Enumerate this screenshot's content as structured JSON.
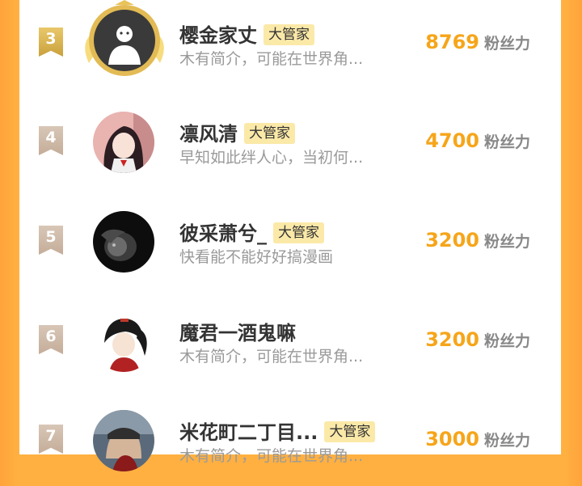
{
  "fans_unit": "粉丝力",
  "rows": [
    {
      "rank": "3",
      "name": "樱金家丈",
      "badge": "大管家",
      "desc": "木有简介，可能在世界角...",
      "fans": "8769"
    },
    {
      "rank": "4",
      "name": "凛风清",
      "badge": "大管家",
      "desc": "早知如此绊人心，当初何...",
      "fans": "4700"
    },
    {
      "rank": "5",
      "name": "彼采萧兮_",
      "badge": "大管家",
      "desc": "快看能不能好好搞漫画",
      "fans": "3200"
    },
    {
      "rank": "6",
      "name": "魔君一酒鬼嘛",
      "badge": "",
      "desc": "木有简介，可能在世界角...",
      "fans": "3200"
    },
    {
      "rank": "7",
      "name": "米花町二丁目...",
      "badge": "大管家",
      "desc": "木有简介，可能在世界角...",
      "fans": "3000"
    }
  ]
}
